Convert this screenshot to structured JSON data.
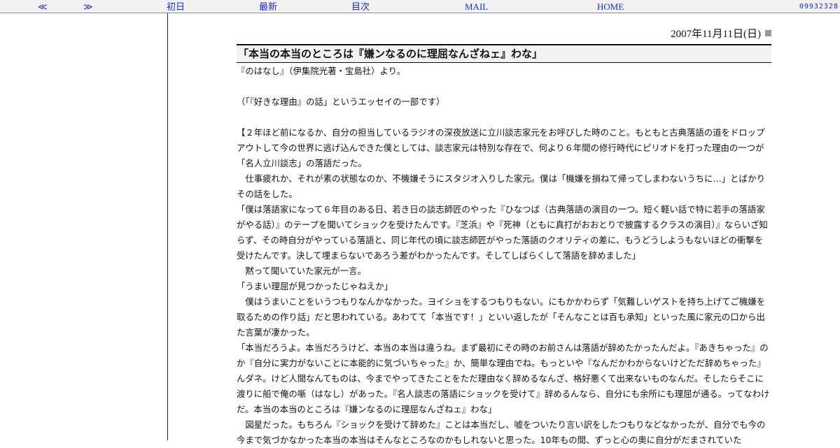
{
  "nav": {
    "prev": "≪",
    "next": "≫",
    "first": "初日",
    "latest": "最新",
    "toc": "目次",
    "mail": "MAIL",
    "home": "HOME",
    "counter": "09932328"
  },
  "entry": {
    "date": "2007年11月11日(日)",
    "title": "「本当の本当のところは『嫌ンなるのに理屈なんざねェ』わな」",
    "paragraphs": [
      "『のはなし』（伊集院光著・宝島社）より。",
      "",
      "（「『好きな理由』の話」というエッセイの一部です）",
      "",
      "【２年ほど前になるか、自分の担当しているラジオの深夜放送に立川談志家元をお呼びした時のこと。もともと古典落語の道をドロップアウトして今の世界に逃げ込んできた僕としては、談志家元は特別な存在で、何より６年間の修行時代にピリオドを打った理由の一つが「名人立川談志」の落語だった。",
      "　仕事疲れか、それが素の状態なのか、不機嫌そうにスタジオ入りした家元。僕は「機嫌を損ねて帰ってしまわないうちに…」とばかりその話をした。",
      "「僕は落語家になって６年目のある日、若き日の談志師匠のやった『ひなつば（古典落語の演目の一つ。短く軽い話で特に若手の落語家がやる話）』のテープを聞いてショックを受けたんです。『芝浜』や『死神（ともに真打がおおとりで披露するクラスの演目）』ならいざ知らず、その時自分がやっている落語と、同じ年代の頃に談志師匠がやった落語のクオリティの差に、もうどうしようもないほどの衝撃を受けたんです。決して埋まらないであろう差がわかったんです。そしてしばらくして落語を辞めました」",
      "　黙って聞いていた家元が一言。",
      "「うまい理屈が見つかったじゃねえか」",
      "　僕はうまいことをいうつもりなんかなかった。ヨイショをするつもりもない。にもかかわらず「気難しいゲストを持ち上げてご機嫌を取るための作り話」だと思われている。あわてて「本当です！」といい返したが「そんなことは百も承知」といった風に家元の口から出た言葉が凄かった。",
      "「本当だろうよ。本当だろうけど、本当の本当は違うね。まず最初にその時のお前さんは落語が辞めたかったんだよ。『あきちゃった』のか『自分に実力がないことに本能的に気づいちゃった』か、簡単な理由でね。もっといや『なんだかわからないけどただ辞めちゃった』んダネ。けど人間なんてものは、今までやってきたことをただ理由なく辞めるなんざ、格好悪くて出来ないものなんだ。そしたらそこに渡りに船で俺の噺（はなし）があった。『名人談志の落語にショックを受けて』辞めるんなら、自分にも余所にも理屈が通る。ってなわけだ。本当の本当のところは『嫌ンなるのに理屈なんざねェ』わな」",
      "　図星だった。もちろん『ショックを受けて辞めた』ことは本当だし、嘘をついたり言い訳をしたつもりなどなかったが、自分でも今の今まで気づかなかった本当の本当はそんなところなのかもしれないと思った。10年もの間、ずっと心の奥に自分がだまされていた"
    ]
  }
}
